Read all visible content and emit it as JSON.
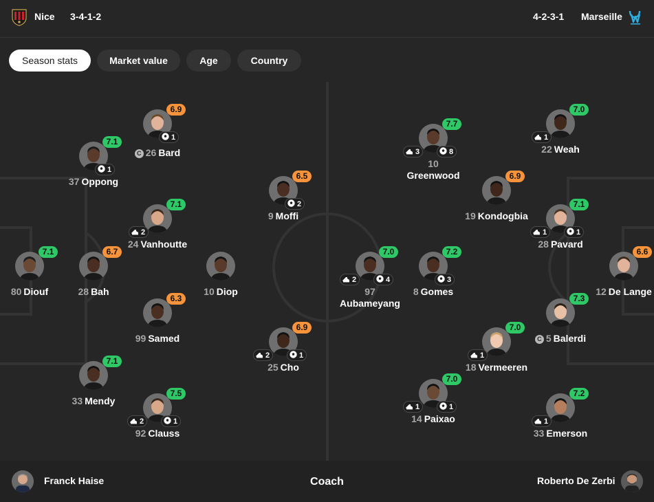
{
  "header": {
    "home": {
      "name": "Nice",
      "formation": "3-4-1-2",
      "logo_icon": "ogc-nice-crest-icon"
    },
    "away": {
      "name": "Marseille",
      "formation": "4-2-3-1",
      "logo_icon": "om-crest-icon"
    }
  },
  "tabs": [
    {
      "label": "Season stats",
      "active": true
    },
    {
      "label": "Market value",
      "active": false
    },
    {
      "label": "Age",
      "active": false
    },
    {
      "label": "Country",
      "active": false
    }
  ],
  "colors": {
    "rating_green": "#2ec866",
    "rating_orange": "#f7943b",
    "background": "#262626"
  },
  "players": [
    {
      "num": "26",
      "name": "Bard",
      "rating": "6.9",
      "rating_color": "orange",
      "captain": true,
      "assists": null,
      "goals": "1",
      "skin": "#e0b39a",
      "hair": "#6b4a2a"
    },
    {
      "num": "37",
      "name": "Oppong",
      "rating": "7.1",
      "rating_color": "green",
      "captain": false,
      "assists": null,
      "goals": "1",
      "skin": "#5a3a2a",
      "hair": "#1b1b1b"
    },
    {
      "num": "24",
      "name": "Vanhoutte",
      "rating": "7.1",
      "rating_color": "green",
      "captain": false,
      "assists": "2",
      "goals": null,
      "skin": "#d9a889",
      "hair": "#3a2a1e"
    },
    {
      "num": "80",
      "name": "Diouf",
      "rating": "7.1",
      "rating_color": "green",
      "captain": false,
      "assists": null,
      "goals": null,
      "skin": "#6b4a35",
      "hair": "#1b1b1b"
    },
    {
      "num": "28",
      "name": "Bah",
      "rating": "6.7",
      "rating_color": "orange",
      "captain": false,
      "assists": null,
      "goals": null,
      "skin": "#4a2e22",
      "hair": "#121212"
    },
    {
      "num": "99",
      "name": "Samed",
      "rating": "6.3",
      "rating_color": "orange",
      "captain": false,
      "assists": null,
      "goals": null,
      "skin": "#4a2e22",
      "hair": "#121212"
    },
    {
      "num": "33",
      "name": "Mendy",
      "rating": "7.1",
      "rating_color": "green",
      "captain": false,
      "assists": null,
      "goals": null,
      "skin": "#4a2e22",
      "hair": "#121212"
    },
    {
      "num": "92",
      "name": "Clauss",
      "rating": "7.5",
      "rating_color": "green",
      "captain": false,
      "assists": "2",
      "goals": "1",
      "skin": "#d9a889",
      "hair": "#3a2a1e"
    },
    {
      "num": "10",
      "name": "Diop",
      "rating": null,
      "rating_color": "",
      "captain": false,
      "assists": null,
      "goals": null,
      "skin": "#5a3a2a",
      "hair": "#121212"
    },
    {
      "num": "9",
      "name": "Moffi",
      "rating": "6.5",
      "rating_color": "orange",
      "captain": false,
      "assists": null,
      "goals": "2",
      "skin": "#4a2e22",
      "hair": "#121212"
    },
    {
      "num": "25",
      "name": "Cho",
      "rating": "6.9",
      "rating_color": "orange",
      "captain": false,
      "assists": "2",
      "goals": "1",
      "skin": "#3f271c",
      "hair": "#121212"
    },
    {
      "num": "97",
      "name": "Aubameyang",
      "rating": "7.0",
      "rating_color": "green",
      "captain": false,
      "assists": "2",
      "goals": "4",
      "skin": "#4a2e22",
      "hair": "#121212"
    },
    {
      "num": "10",
      "name": "Greenwood",
      "rating": "7.7",
      "rating_color": "green",
      "captain": false,
      "assists": "3",
      "goals": "8",
      "skin": "#5a3a2a",
      "hair": "#121212"
    },
    {
      "num": "19",
      "name": "Kondogbia",
      "rating": "6.9",
      "rating_color": "orange",
      "captain": false,
      "assists": null,
      "goals": null,
      "skin": "#3f271c",
      "hair": "#121212"
    },
    {
      "num": "8",
      "name": "Gomes",
      "rating": "7.2",
      "rating_color": "green",
      "captain": false,
      "assists": null,
      "goals": "3",
      "skin": "#4a2e22",
      "hair": "#121212"
    },
    {
      "num": "22",
      "name": "Weah",
      "rating": "7.0",
      "rating_color": "green",
      "captain": false,
      "assists": "1",
      "goals": null,
      "skin": "#3f271c",
      "hair": "#121212"
    },
    {
      "num": "28",
      "name": "Pavard",
      "rating": "7.1",
      "rating_color": "green",
      "captain": false,
      "assists": "1",
      "goals": "1",
      "skin": "#e0b39a",
      "hair": "#4a3522"
    },
    {
      "num": "12",
      "name": "De Lange",
      "rating": "6.6",
      "rating_color": "orange",
      "captain": false,
      "assists": null,
      "goals": null,
      "skin": "#e0b39a",
      "hair": "#3a2a1e"
    },
    {
      "num": "5",
      "name": "Balerdi",
      "rating": "7.3",
      "rating_color": "green",
      "captain": true,
      "assists": null,
      "goals": null,
      "skin": "#e8c0a5",
      "hair": "#2a1e14"
    },
    {
      "num": "18",
      "name": "Vermeeren",
      "rating": "7.0",
      "rating_color": "green",
      "captain": false,
      "assists": "1",
      "goals": null,
      "skin": "#f0c9b0",
      "hair": "#c9a06a"
    },
    {
      "num": "14",
      "name": "Paixao",
      "rating": "7.0",
      "rating_color": "green",
      "captain": false,
      "assists": "1",
      "goals": "1",
      "skin": "#6b4a35",
      "hair": "#121212"
    },
    {
      "num": "33",
      "name": "Emerson",
      "rating": "7.2",
      "rating_color": "green",
      "captain": false,
      "assists": "1",
      "goals": null,
      "skin": "#b57e5c",
      "hair": "#121212"
    }
  ],
  "coaches": {
    "label": "Coach",
    "home": {
      "name": "Franck Haise"
    },
    "away": {
      "name": "Roberto De Zerbi"
    }
  }
}
